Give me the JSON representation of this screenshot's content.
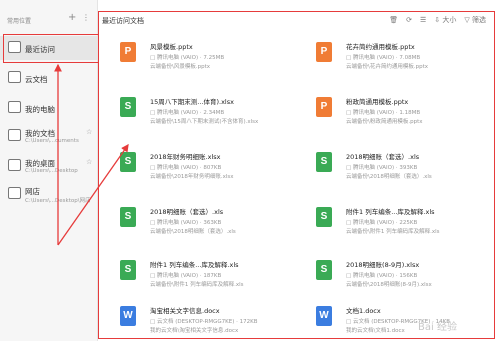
{
  "sidebar": {
    "header": "常用位置",
    "plus": "+",
    "more": "⋮",
    "items": [
      {
        "label": "最近访问",
        "sub": "",
        "pin": ""
      },
      {
        "label": "云文档",
        "sub": "",
        "pin": ""
      },
      {
        "label": "我的电脑",
        "sub": "",
        "pin": ""
      },
      {
        "label": "我的文档",
        "sub": "C:\\Users\\...cuments",
        "pin": "☆"
      },
      {
        "label": "我的桌面",
        "sub": "C:\\Users\\...Desktop",
        "pin": "☆"
      },
      {
        "label": "网店",
        "sub": "C:\\Users\\...Desktop\\网店",
        "pin": ""
      }
    ]
  },
  "main": {
    "title": "最近访问文档",
    "toolbar": {
      "trash": "🗑",
      "refresh": "⟳",
      "list": "☰",
      "sort": "⇩ 大小",
      "filter": "▽ 筛选"
    }
  },
  "files": [
    {
      "name": "风景模板.pptx",
      "meta": "□ 腾讯电脑 (VAIO)  ·  7.25MB",
      "path": "云端备份\\风景模板.pptx",
      "type": "P"
    },
    {
      "name": "花卉简约通用模板.pptx",
      "meta": "□ 腾讯电脑 (VAIO)  ·  7.08MB",
      "path": "云端备份\\花卉简约通用模板.pptx",
      "type": "P"
    },
    {
      "name": "15周八下期末测...体育).xlsx",
      "meta": "□ 腾讯电脑 (VAIO)  ·  2.34MB",
      "path": "云端备份\\15周八下期末测试(不含体育).xlsx",
      "type": "S"
    },
    {
      "name": "粉政简通用模板.pptx",
      "meta": "□ 腾讯电脑 (VAIO)  ·  1.18MB",
      "path": "云端备份\\粉政简通用模板.pptx",
      "type": "P"
    },
    {
      "name": "2018年财务明细账.xlsx",
      "meta": "□ 腾讯电脑 (VAIO)  ·  807KB",
      "path": "云端备份\\2018年财务明细账.xlsx",
      "type": "S"
    },
    {
      "name": "2018明细账（套选）.xls",
      "meta": "□ 腾讯电脑 (VAIO)  ·  393KB",
      "path": "云端备份\\2018明细账（套选）.xls",
      "type": "S"
    },
    {
      "name": "2018明细账（套选）.xls",
      "meta": "□ 腾讯电脑 (VAIO)  ·  363KB",
      "path": "云端备份\\2018明细账（套选）.xls",
      "type": "S"
    },
    {
      "name": "附件1 列车编条...库及解释.xls",
      "meta": "□ 腾讯电脑 (VAIO)  ·  225KB",
      "path": "云端备份\\附件1 列车编码库及解释.xls",
      "type": "S"
    },
    {
      "name": "附件1 列车编条...库及解释.xls",
      "meta": "□ 腾讯电脑 (VAIO)  ·  187KB",
      "path": "云端备份\\附件1 列车编码库及解释.xls",
      "type": "S"
    },
    {
      "name": "2018明细账(8-9月).xlsx",
      "meta": "□ 腾讯电脑 (VAIO)  ·  156KB",
      "path": "云端备份\\2018明细账(8-9月).xlsx",
      "type": "S"
    },
    {
      "name": "淘宝相关文字信息.docx",
      "meta": "□ 云文档 (DESKTOP-RMGG7KE)  ·  172KB",
      "path": "我的云文档\\淘宝相关文字信息.docx",
      "type": "W"
    },
    {
      "name": "文档1.docx",
      "meta": "□ 云文档 (DESKTOP-RMGG7KE)  ·  14KB",
      "path": "我的云文档\\文档1.docx",
      "type": "W"
    }
  ],
  "watermark": "Bai 经验"
}
